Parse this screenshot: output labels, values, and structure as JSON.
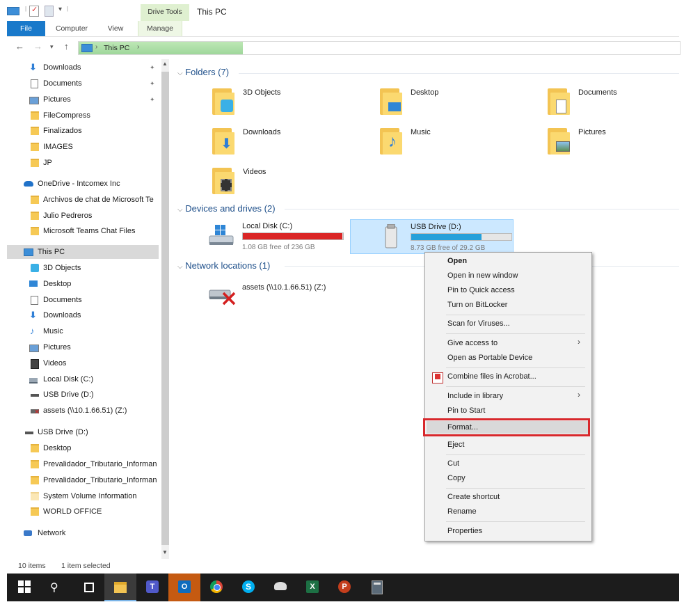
{
  "titlebar": {
    "drive_tools": "Drive Tools",
    "window_title": "This PC"
  },
  "ribbon": {
    "tabs": [
      "File",
      "Computer",
      "View",
      "Manage"
    ]
  },
  "address": {
    "location": "This PC"
  },
  "sidebar": {
    "quick_access": [
      {
        "label": "Downloads",
        "icon": "download-arrow-icon",
        "pinned": true
      },
      {
        "label": "Documents",
        "icon": "documents-icon",
        "pinned": true
      },
      {
        "label": "Pictures",
        "icon": "pictures-icon",
        "pinned": true
      },
      {
        "label": "FileCompress",
        "icon": "folder-icon"
      },
      {
        "label": "Finalizados",
        "icon": "folder-icon"
      },
      {
        "label": "IMAGES",
        "icon": "folder-icon"
      },
      {
        "label": "JP",
        "icon": "folder-icon"
      }
    ],
    "onedrive": {
      "label": "OneDrive - Intcomex Inc",
      "items": [
        "Archivos de chat de Microsoft Te",
        "Julio Pedreros",
        "Microsoft Teams Chat Files"
      ]
    },
    "this_pc": {
      "label": "This PC",
      "items": [
        {
          "label": "3D Objects",
          "icon": "3d-objects-icon"
        },
        {
          "label": "Desktop",
          "icon": "desktop-icon"
        },
        {
          "label": "Documents",
          "icon": "documents-icon"
        },
        {
          "label": "Downloads",
          "icon": "download-arrow-icon"
        },
        {
          "label": "Music",
          "icon": "music-note-icon"
        },
        {
          "label": "Pictures",
          "icon": "pictures-icon"
        },
        {
          "label": "Videos",
          "icon": "videos-icon"
        },
        {
          "label": "Local Disk (C:)",
          "icon": "local-disk-icon"
        },
        {
          "label": "USB Drive (D:)",
          "icon": "usb-drive-icon"
        },
        {
          "label": "assets (\\\\10.1.66.51) (Z:)",
          "icon": "network-drive-disconnected-icon"
        }
      ]
    },
    "usb_drive": {
      "label": "USB Drive (D:)",
      "items": [
        "Desktop",
        "Prevalidador_Tributario_Informan",
        "Prevalidador_Tributario_Informan",
        "System Volume Information",
        "WORLD OFFICE"
      ]
    },
    "network": "Network"
  },
  "main": {
    "folders_header": "Folders (7)",
    "folders": [
      {
        "label": "3D Objects",
        "icon": "3d-objects-folder-icon"
      },
      {
        "label": "Desktop",
        "icon": "desktop-folder-icon"
      },
      {
        "label": "Documents",
        "icon": "documents-folder-icon"
      },
      {
        "label": "Downloads",
        "icon": "downloads-folder-icon"
      },
      {
        "label": "Music",
        "icon": "music-folder-icon"
      },
      {
        "label": "Pictures",
        "icon": "pictures-folder-icon"
      },
      {
        "label": "Videos",
        "icon": "videos-folder-icon"
      }
    ],
    "devices_header": "Devices and drives (2)",
    "drives": [
      {
        "label": "Local Disk (C:)",
        "free_text": "1.08 GB free of 236 GB",
        "used_fraction": 0.995,
        "bar_color": "#da2626"
      },
      {
        "label": "USB Drive (D:)",
        "free_text": "8.73 GB free of 29.2 GB",
        "used_fraction": 0.7,
        "bar_color": "#26a0da"
      }
    ],
    "network_header": "Network locations (1)",
    "network_locations": [
      {
        "label": "assets (\\\\10.1.66.51) (Z:)",
        "icon": "network-drive-disconnected-icon"
      }
    ]
  },
  "context_menu": {
    "items": [
      "Open",
      "Open in new window",
      "Pin to Quick access",
      "Turn on BitLocker",
      "Scan for Viruses...",
      "Give access to",
      "Open as Portable Device",
      "Combine files in Acrobat...",
      "Include in library",
      "Pin to Start",
      "Format...",
      "Eject",
      "Cut",
      "Copy",
      "Create shortcut",
      "Rename",
      "Properties"
    ],
    "highlighted": "Format...",
    "highlight_color": "#d8282c"
  },
  "status": {
    "item_count": "10 items",
    "selection": "1 item selected"
  },
  "taskbar": {
    "icons": [
      "windows-start-icon",
      "search-icon",
      "task-view-icon",
      "file-explorer-icon",
      "teams-icon",
      "outlook-icon",
      "chrome-icon",
      "skype-icon",
      "network-app-icon",
      "excel-icon",
      "powerpoint-icon",
      "calculator-icon"
    ]
  }
}
